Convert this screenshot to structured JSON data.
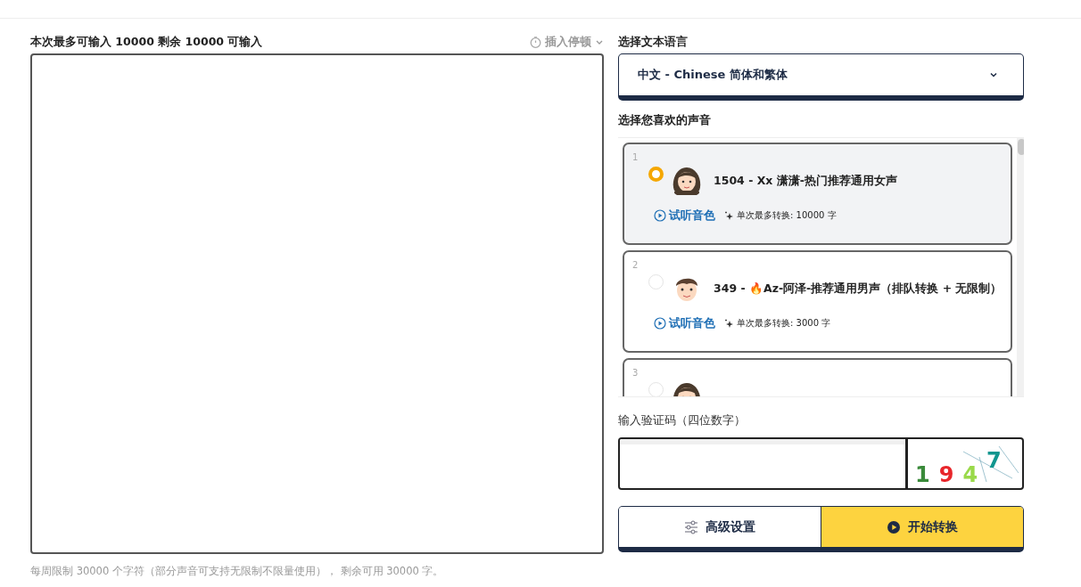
{
  "editor": {
    "limit_label": "本次最多可输入 10000 剩余 10000 可输入",
    "pause_menu": {
      "label": "插入停顿",
      "expanded": false
    },
    "footer": "每周限制 30000 个字符（部分声音可支持无限制不限量使用）， 剩余可用 30000 字。"
  },
  "language": {
    "label": "选择文本语言",
    "value": "中文 - Chinese 简体和繁体"
  },
  "voices": {
    "label": "选择您喜欢的声音",
    "items": [
      {
        "index": "1",
        "name": "1504 - Xx 潇潇-热门推荐通用女声",
        "selected": true,
        "preview": "试听音色",
        "limit": "单次最多转换: 10000 字"
      },
      {
        "index": "2",
        "name": "349 - 🔥Az-阿泽-推荐通用男声（排队转换 + 无限制）",
        "selected": false,
        "preview": "试听音色",
        "limit": "单次最多转换: 3000 字"
      },
      {
        "index": "3",
        "selected": false
      }
    ]
  },
  "captcha": {
    "label": "输入验证码（四位数字）",
    "chars": [
      {
        "text": "1",
        "color": "#3a8a3a"
      },
      {
        "text": "9",
        "color": "#e8262b"
      },
      {
        "text": "4",
        "color": "#9ad94a"
      },
      {
        "text": "7",
        "color": "#11968f"
      }
    ]
  },
  "buttons": [
    {
      "kind": "settings",
      "label": "高级设置"
    },
    {
      "kind": "start",
      "label": "开始转换"
    }
  ]
}
